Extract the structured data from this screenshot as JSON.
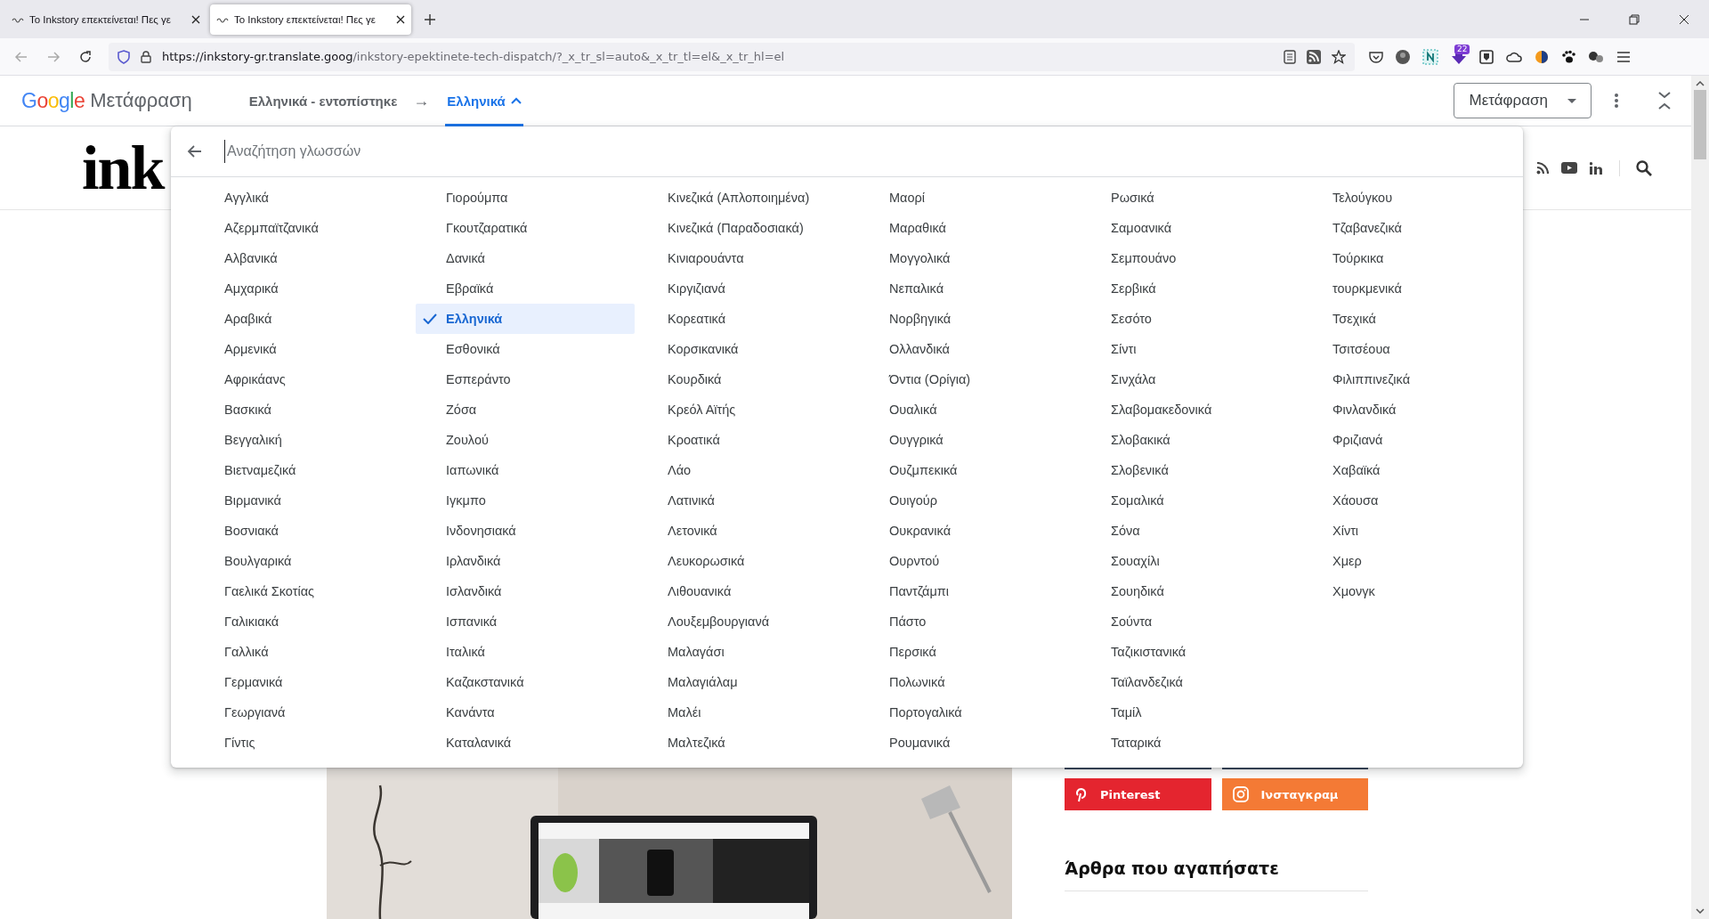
{
  "browser": {
    "tabs": [
      {
        "title": "Το Inkstory επεκτείνεται! Πες γε",
        "selected": false
      },
      {
        "title": "Το Inkstory επεκτείνεται! Πες γε",
        "selected": true
      }
    ],
    "url": {
      "host": "https://inkstory-gr.translate.goog",
      "path": "/inkstory-epektinete-tech-dispatch/?_x_tr_sl=auto&_x_tr_tl=el&_x_tr_hl=el"
    },
    "extension_badge": "22"
  },
  "translate_bar": {
    "logo": "Google",
    "product": "Μετάφραση",
    "source_language": "Ελληνικά - εντοπίστηκε",
    "arrow": "→",
    "target_language": "Ελληνικά",
    "target_expanded": true,
    "mode_button": "Μετάφραση"
  },
  "language_menu": {
    "search_placeholder": "Αναζήτηση γλωσσών",
    "languages": [
      {
        "name": "Αγγλικά",
        "selected": false
      },
      {
        "name": "Αζερμπαϊτζανικά",
        "selected": false
      },
      {
        "name": "Αλβανικά",
        "selected": false
      },
      {
        "name": "Αμχαρικά",
        "selected": false
      },
      {
        "name": "Αραβικά",
        "selected": false
      },
      {
        "name": "Αρμενικά",
        "selected": false
      },
      {
        "name": "Αφρικάανς",
        "selected": false
      },
      {
        "name": "Βασκικά",
        "selected": false
      },
      {
        "name": "Βεγγαλική",
        "selected": false
      },
      {
        "name": "Βιετναμεζικά",
        "selected": false
      },
      {
        "name": "Βιρμανικά",
        "selected": false
      },
      {
        "name": "Βοσνιακά",
        "selected": false
      },
      {
        "name": "Βουλγαρικά",
        "selected": false
      },
      {
        "name": "Γαελικά Σκοτίας",
        "selected": false
      },
      {
        "name": "Γαλικιακά",
        "selected": false
      },
      {
        "name": "Γαλλικά",
        "selected": false
      },
      {
        "name": "Γερμανικά",
        "selected": false
      },
      {
        "name": "Γεωργιανά",
        "selected": false
      },
      {
        "name": "Γίντις",
        "selected": false
      },
      {
        "name": "Γιορούμπα",
        "selected": false
      },
      {
        "name": "Γκουτζαρατικά",
        "selected": false
      },
      {
        "name": "Δανικά",
        "selected": false
      },
      {
        "name": "Εβραϊκά",
        "selected": false
      },
      {
        "name": "Ελληνικά",
        "selected": true
      },
      {
        "name": "Εσθονικά",
        "selected": false
      },
      {
        "name": "Εσπεράντο",
        "selected": false
      },
      {
        "name": "Ζόσα",
        "selected": false
      },
      {
        "name": "Ζουλού",
        "selected": false
      },
      {
        "name": "Ιαπωνικά",
        "selected": false
      },
      {
        "name": "Ιγκμπο",
        "selected": false
      },
      {
        "name": "Ινδονησιακά",
        "selected": false
      },
      {
        "name": "Ιρλανδικά",
        "selected": false
      },
      {
        "name": "Ισλανδικά",
        "selected": false
      },
      {
        "name": "Ισπανικά",
        "selected": false
      },
      {
        "name": "Ιταλικά",
        "selected": false
      },
      {
        "name": "Καζακστανικά",
        "selected": false
      },
      {
        "name": "Κανάντα",
        "selected": false
      },
      {
        "name": "Καταλανικά",
        "selected": false
      },
      {
        "name": "Κινεζικά (Απλοποιημένα)",
        "selected": false
      },
      {
        "name": "Κινεζικά (Παραδοσιακά)",
        "selected": false
      },
      {
        "name": "Κινιαρουάντα",
        "selected": false
      },
      {
        "name": "Κιργιζιανά",
        "selected": false
      },
      {
        "name": "Κορεατικά",
        "selected": false
      },
      {
        "name": "Κορσικανικά",
        "selected": false
      },
      {
        "name": "Κουρδικά",
        "selected": false
      },
      {
        "name": "Κρεόλ Αϊτής",
        "selected": false
      },
      {
        "name": "Κροατικά",
        "selected": false
      },
      {
        "name": "Λάο",
        "selected": false
      },
      {
        "name": "Λατινικά",
        "selected": false
      },
      {
        "name": "Λετονικά",
        "selected": false
      },
      {
        "name": "Λευκορωσικά",
        "selected": false
      },
      {
        "name": "Λιθουανικά",
        "selected": false
      },
      {
        "name": "Λουξεμβουργιανά",
        "selected": false
      },
      {
        "name": "Μαλαγάσι",
        "selected": false
      },
      {
        "name": "Μαλαγιάλαμ",
        "selected": false
      },
      {
        "name": "Μαλέι",
        "selected": false
      },
      {
        "name": "Μαλτεζικά",
        "selected": false
      },
      {
        "name": "Μαορί",
        "selected": false
      },
      {
        "name": "Μαραθικά",
        "selected": false
      },
      {
        "name": "Μογγολικά",
        "selected": false
      },
      {
        "name": "Νεπαλικά",
        "selected": false
      },
      {
        "name": "Νορβηγικά",
        "selected": false
      },
      {
        "name": "Ολλανδικά",
        "selected": false
      },
      {
        "name": "Όντια (Ορίγια)",
        "selected": false
      },
      {
        "name": "Ουαλικά",
        "selected": false
      },
      {
        "name": "Ουγγρικά",
        "selected": false
      },
      {
        "name": "Ουζμπεκικά",
        "selected": false
      },
      {
        "name": "Ουιγούρ",
        "selected": false
      },
      {
        "name": "Ουκρανικά",
        "selected": false
      },
      {
        "name": "Ουρντού",
        "selected": false
      },
      {
        "name": "Παντζάμπι",
        "selected": false
      },
      {
        "name": "Πάστο",
        "selected": false
      },
      {
        "name": "Περσικά",
        "selected": false
      },
      {
        "name": "Πολωνικά",
        "selected": false
      },
      {
        "name": "Πορτογαλικά",
        "selected": false
      },
      {
        "name": "Ρουμανικά",
        "selected": false
      },
      {
        "name": "Ρωσικά",
        "selected": false
      },
      {
        "name": "Σαμοανικά",
        "selected": false
      },
      {
        "name": "Σεμπουάνο",
        "selected": false
      },
      {
        "name": "Σερβικά",
        "selected": false
      },
      {
        "name": "Σεσότο",
        "selected": false
      },
      {
        "name": "Σίντι",
        "selected": false
      },
      {
        "name": "Σινχάλα",
        "selected": false
      },
      {
        "name": "Σλαβομακεδονικά",
        "selected": false
      },
      {
        "name": "Σλοβακικά",
        "selected": false
      },
      {
        "name": "Σλοβενικά",
        "selected": false
      },
      {
        "name": "Σομαλικά",
        "selected": false
      },
      {
        "name": "Σόνα",
        "selected": false
      },
      {
        "name": "Σουαχίλι",
        "selected": false
      },
      {
        "name": "Σουηδικά",
        "selected": false
      },
      {
        "name": "Σούντα",
        "selected": false
      },
      {
        "name": "Ταζικιστανικά",
        "selected": false
      },
      {
        "name": "Ταϊλανδεζικά",
        "selected": false
      },
      {
        "name": "Ταμίλ",
        "selected": false
      },
      {
        "name": "Ταταρικά",
        "selected": false
      },
      {
        "name": "Τελούγκου",
        "selected": false
      },
      {
        "name": "Τζαβανεζικά",
        "selected": false
      },
      {
        "name": "Τούρκικα",
        "selected": false
      },
      {
        "name": "τουρκμενικά",
        "selected": false
      },
      {
        "name": "Τσεχικά",
        "selected": false
      },
      {
        "name": "Τσιτσέουα",
        "selected": false
      },
      {
        "name": "Φιλιππινεζικά",
        "selected": false
      },
      {
        "name": "Φινλανδικά",
        "selected": false
      },
      {
        "name": "Φριζιανά",
        "selected": false
      },
      {
        "name": "Χαβαϊκά",
        "selected": false
      },
      {
        "name": "Χάουσα",
        "selected": false
      },
      {
        "name": "Χίντι",
        "selected": false
      },
      {
        "name": "Χμερ",
        "selected": false
      },
      {
        "name": "Χμονγκ",
        "selected": false
      }
    ]
  },
  "page": {
    "logo": "ink",
    "social_buttons": [
      {
        "label": "Pinterest",
        "kind": "pinterest",
        "color": "#e4252f"
      },
      {
        "label": "Ινσταγκραμ",
        "kind": "instagram",
        "color": "#f47a35"
      }
    ],
    "section_heading": "Άρθρα που αγαπήσατε"
  }
}
